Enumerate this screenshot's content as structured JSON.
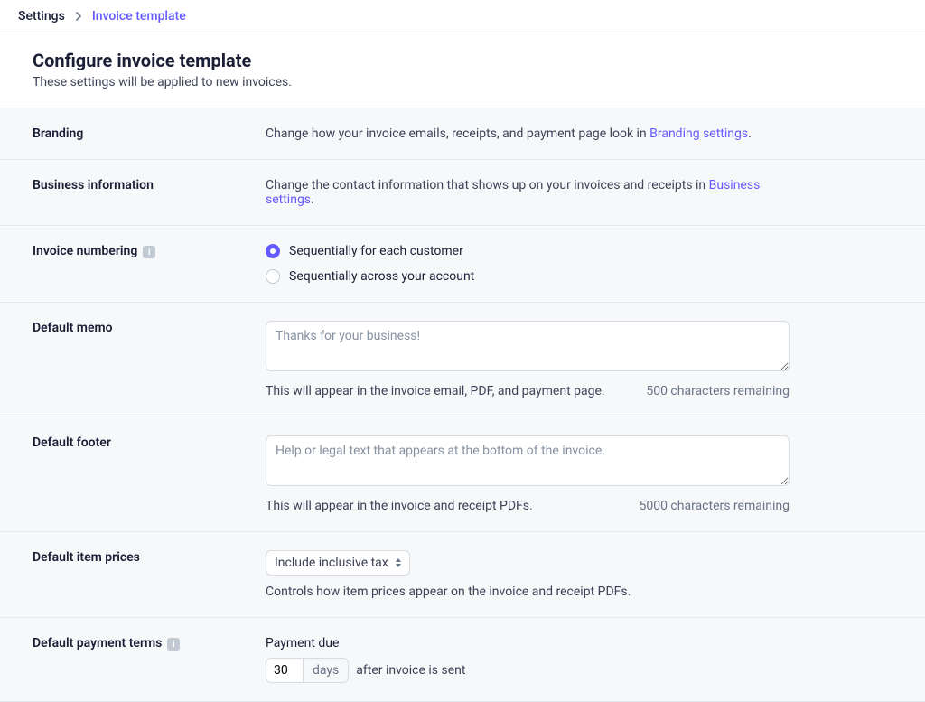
{
  "breadcrumb": {
    "parent": "Settings",
    "current": "Invoice template"
  },
  "header": {
    "title": "Configure invoice template",
    "subtitle": "These settings will be applied to new invoices."
  },
  "branding": {
    "label": "Branding",
    "text_before": "Change how your invoice emails, receipts, and payment page look in ",
    "link": "Branding settings",
    "text_after": "."
  },
  "business": {
    "label": "Business information",
    "text_before": "Change the contact information that shows up on your invoices and receipts in ",
    "link": "Business settings",
    "text_after": "."
  },
  "numbering": {
    "label": "Invoice numbering",
    "options": {
      "per_customer": "Sequentially for each customer",
      "across_account": "Sequentially across your account"
    },
    "selected": "per_customer"
  },
  "memo": {
    "label": "Default memo",
    "placeholder": "Thanks for your business!",
    "value": "",
    "help": "This will appear in the invoice email, PDF, and payment page.",
    "remaining": "500 characters remaining"
  },
  "footer": {
    "label": "Default footer",
    "placeholder": "Help or legal text that appears at the bottom of the invoice.",
    "value": "",
    "help": "This will appear in the invoice and receipt PDFs.",
    "remaining": "5000 characters remaining"
  },
  "item_prices": {
    "label": "Default item prices",
    "selected": "Include inclusive tax",
    "help": "Controls how item prices appear on the invoice and receipt PDFs."
  },
  "payment_terms": {
    "label": "Default payment terms",
    "field_title": "Payment due",
    "value": "30",
    "unit": "days",
    "after_text": "after invoice is sent"
  },
  "info_icon_glyph": "i"
}
